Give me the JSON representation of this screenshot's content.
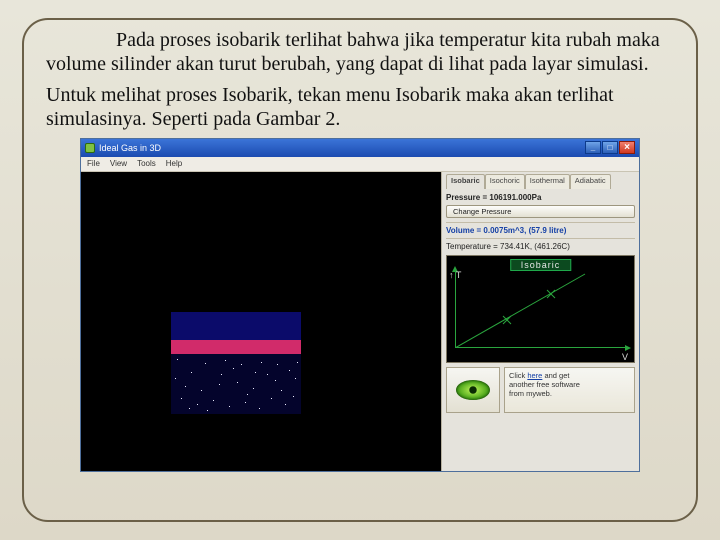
{
  "paragraph": {
    "p1": "Pada proses isobarik terlihat bahwa jika temperatur kita rubah maka volume silinder akan turut berubah, yang dapat di lihat pada layar simulasi.",
    "p2": "Untuk melihat proses Isobarik, tekan menu Isobarik maka akan terlihat simulasinya. Seperti pada Gambar 2."
  },
  "window": {
    "title": "Ideal Gas in 3D",
    "min_label": "_",
    "max_label": "□",
    "close_label": "×"
  },
  "menubar": {
    "items": [
      "File",
      "View",
      "Tools",
      "Help"
    ]
  },
  "tabs": {
    "items": [
      "Isobaric",
      "Isochoric",
      "Isothermal",
      "Adiabatic"
    ],
    "active_index": 0
  },
  "panel": {
    "pressure_line": "Pressure = 106191.000Pa",
    "change_pressure_btn": "Change Pressure",
    "volume_line": "Volume = 0.0075m^3, (57.9 litre)",
    "temperature_line": "Temperature = 734.41K, (461.26C)"
  },
  "graph": {
    "title": "Isobaric",
    "ylabel": "↑ T",
    "xlabel": "V",
    "cross_marks": 2
  },
  "promo": {
    "line1_a": "Click ",
    "line1_link": "here",
    "line1_b": " and get",
    "line2": "another free software",
    "line3": "from myweb."
  }
}
